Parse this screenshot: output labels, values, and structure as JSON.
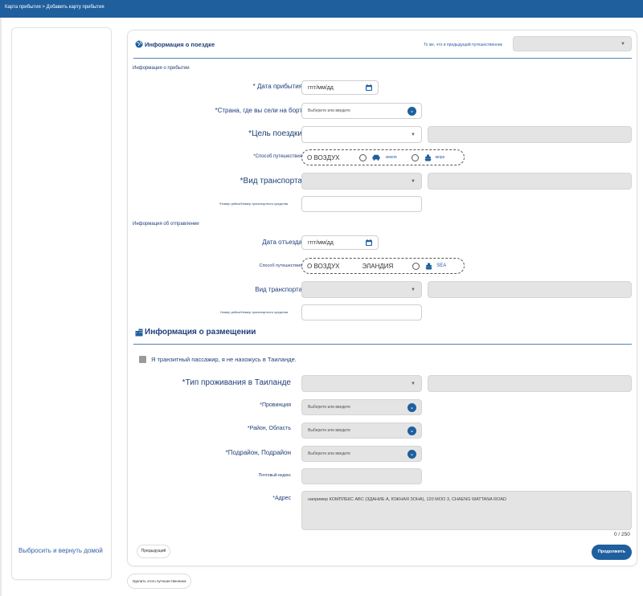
{
  "breadcrumb": "Карта прибытия > Добавить карту прибытия",
  "sidebar": {
    "reset_link": "Выбросить и вернуть домой"
  },
  "trip": {
    "title": "Информация о поездке",
    "same_as_previous_label": "То же, что и предыдущий путешественник",
    "arrival_section": "Информация о прибытии",
    "arrival_date_label": "* Дата прибытия",
    "date_placeholder": "гггг/мм/дд",
    "boarding_country_label": "*Страна, где вы сели на борт",
    "select_or_enter": "Выберите или введите",
    "purpose_label": "*Цель поездки",
    "travel_mode_label": "*Способ путешествия",
    "mode_air": "О ВОЗДУХ",
    "mode_land": "земля",
    "mode_sea": "море",
    "transport_type_label": "*Вид транспорта",
    "flight_number_label": "*Номер рейса/Номер транспортного средства",
    "departure_section": "Информация об отправлении",
    "departure_date_label": "Дата отъезда",
    "dep_travel_mode_label": "Способ путешествия",
    "dep_mode_air": "О ВОЗДУХ",
    "dep_mode_land": "ЭЛАНДИЯ",
    "dep_mode_sea": "SEA",
    "dep_transport_type_label": "Вид транспорта",
    "dep_flight_number_label": "Номер рейса/Номер транспортного средства"
  },
  "accommodation": {
    "title": "Информация о размещении",
    "transit_checkbox": "Я транзитный пассажир, я не нахожусь в Таиланде.",
    "stay_type_label": "*Тип проживания в Таиланде",
    "province_label": "*Провинция",
    "district_label": "*Район, Область",
    "subdistrict_label": "*Подрайон, Подрайон",
    "postal_label": "Почтовый индекс",
    "address_label": "*Адрес",
    "address_placeholder": "например КОМПЛЕКС ABC (ЗДАНИЕ A, ЮЖНАЯ ЗОНА), 120 MOO 3, CHAENG WATTANA ROAD",
    "counter": "0 / 250"
  },
  "buttons": {
    "prev": "Предыдущий",
    "next": "Продолжить",
    "delete_traveler": "Удалить этого путешественника"
  },
  "colors": {
    "brand": "#1f5f9e",
    "text": "#1f3f7a"
  }
}
